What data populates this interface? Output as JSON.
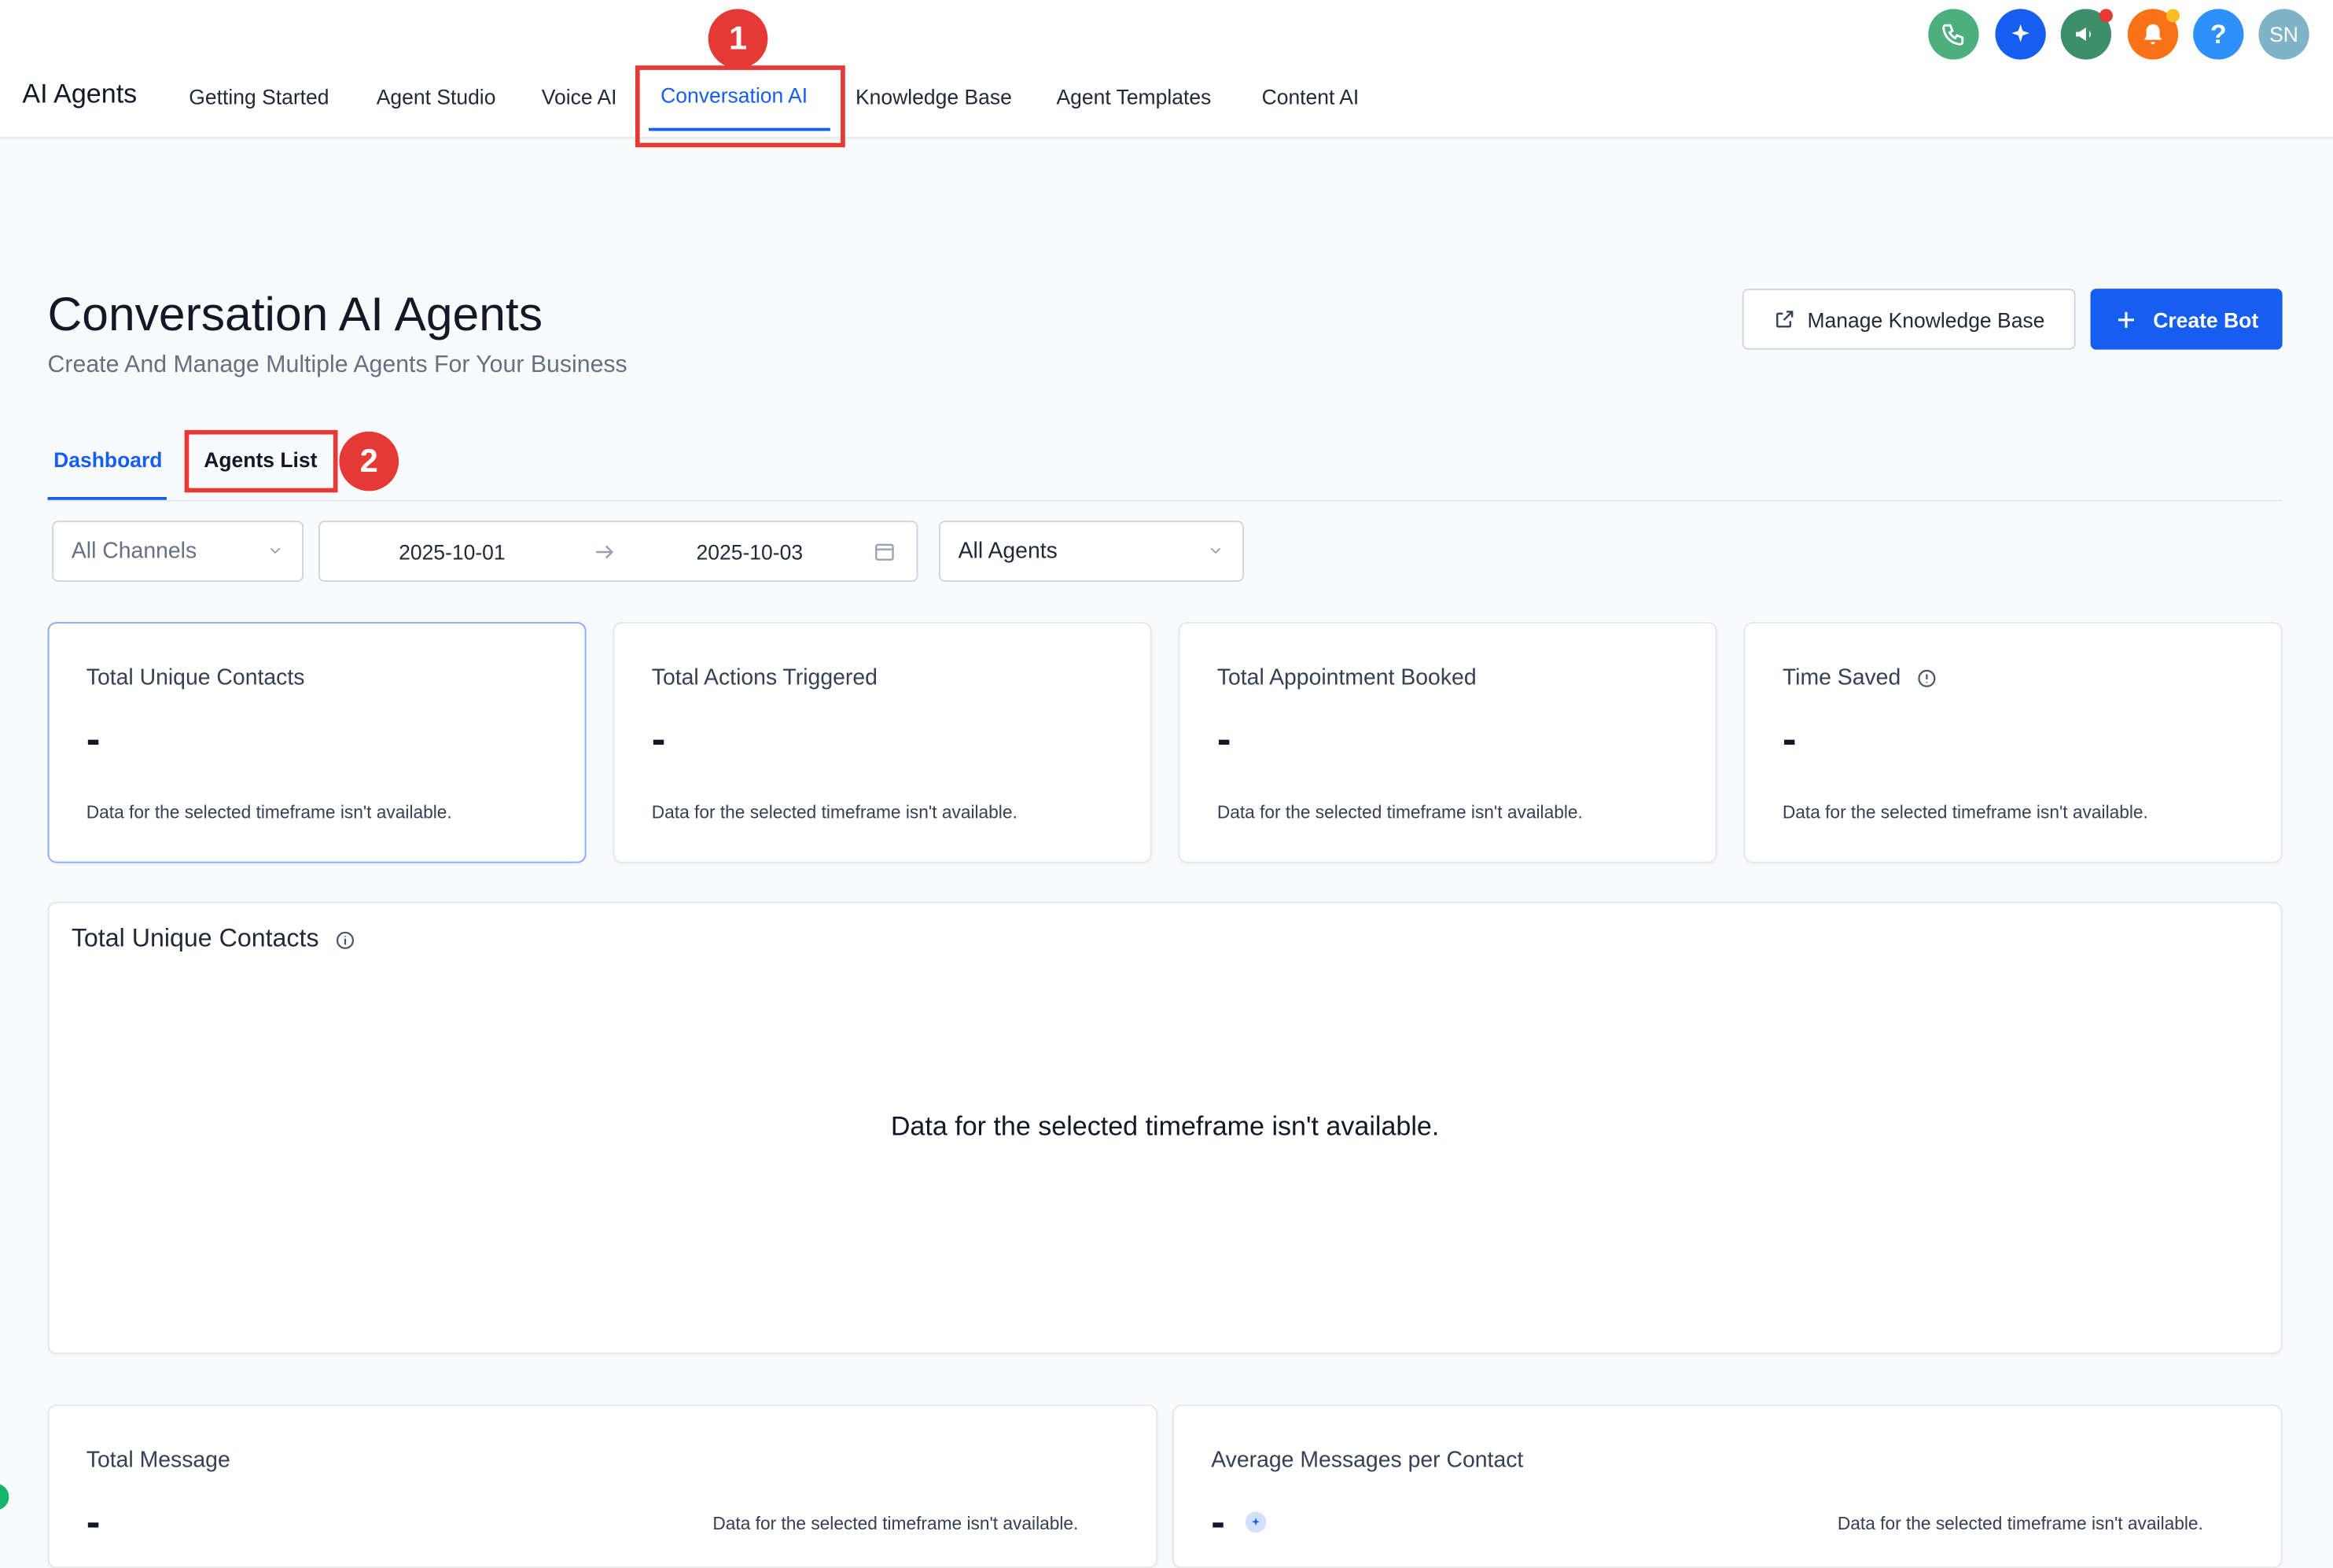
{
  "app": {
    "title": "AI Agents"
  },
  "nav": {
    "items": [
      {
        "label": "Getting Started"
      },
      {
        "label": "Agent Studio"
      },
      {
        "label": "Voice AI"
      },
      {
        "label": "Conversation AI",
        "active": true
      },
      {
        "label": "Knowledge Base"
      },
      {
        "label": "Agent Templates"
      },
      {
        "label": "Content AI"
      }
    ]
  },
  "top_icons": [
    {
      "name": "phone-icon",
      "color": "#4caf7d"
    },
    {
      "name": "sparkle-icon",
      "color": "#155eef"
    },
    {
      "name": "megaphone-icon",
      "color": "#3d8f6a",
      "badge_color": "#e53935"
    },
    {
      "name": "bell-icon",
      "color": "#f97316",
      "badge_color": "#fbbf24"
    },
    {
      "name": "help-icon",
      "color": "#2e90fa"
    },
    {
      "name": "avatar",
      "color": "#7fb3c7",
      "initials": "SN"
    }
  ],
  "annotations": {
    "step1": "1",
    "step2": "2"
  },
  "header": {
    "title": "Conversation AI Agents",
    "subtitle": "Create And Manage Multiple Agents For Your Business",
    "manage_kb_label": "Manage Knowledge Base",
    "create_bot_label": "Create Bot"
  },
  "tabs": [
    {
      "label": "Dashboard",
      "active": true
    },
    {
      "label": "Agents List"
    }
  ],
  "filters": {
    "channel": "All Channels",
    "date_start": "2025-10-01",
    "date_end": "2025-10-03",
    "agent": "All Agents"
  },
  "stat_cards": [
    {
      "title": "Total Unique Contacts",
      "value": "-",
      "note": "Data for the selected timeframe isn't available."
    },
    {
      "title": "Total Actions Triggered",
      "value": "-",
      "note": "Data for the selected timeframe isn't available."
    },
    {
      "title": "Total Appointment Booked",
      "value": "-",
      "note": "Data for the selected timeframe isn't available."
    },
    {
      "title": "Time Saved",
      "value": "-",
      "note": "Data for the selected timeframe isn't available."
    }
  ],
  "chart_panel": {
    "title": "Total Unique Contacts",
    "empty_message": "Data for the selected timeframe isn't available."
  },
  "bottom_cards": [
    {
      "title": "Total Message",
      "value": "-",
      "note": "Data for the selected timeframe isn't available."
    },
    {
      "title": "Average Messages per Contact",
      "value": "-",
      "note": "Data for the selected timeframe isn't available."
    }
  ],
  "colors": {
    "primary": "#155eef",
    "annotation": "#e53935"
  }
}
